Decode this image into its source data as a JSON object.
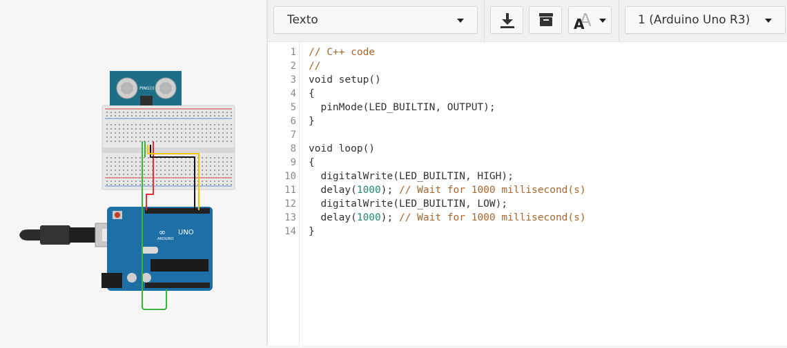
{
  "toolbar": {
    "mode_select": "Texto",
    "download_icon": "download-icon",
    "library_icon": "library-icon",
    "font_size_icon": "font-size-icon",
    "font_size_glyph": "A",
    "board_select": "1 (Arduino Uno R3)"
  },
  "circuit": {
    "usb_cable_icon": "usb-cable-icon",
    "arduino_icon": "arduino-uno-icon",
    "breadboard_icon": "breadboard-icon",
    "sensor_icon": "ultrasonic-sensor-icon",
    "board_logo_text": "UNO",
    "board_brand_text": "ARDUINO",
    "sensor_label": "PING)))"
  },
  "editor": {
    "line_numbers": [
      "1",
      "2",
      "3",
      "4",
      "5",
      "6",
      "7",
      "8",
      "9",
      "10",
      "11",
      "12",
      "13",
      "14"
    ],
    "lines": [
      [
        {
          "t": "// C++ code",
          "c": "comment"
        }
      ],
      [
        {
          "t": "//",
          "c": "comment"
        }
      ],
      [
        {
          "t": "void setup()",
          "c": "plain"
        }
      ],
      [
        {
          "t": "{",
          "c": "plain"
        }
      ],
      [
        {
          "t": "  pinMode(LED_BUILTIN, OUTPUT);",
          "c": "plain"
        }
      ],
      [
        {
          "t": "}",
          "c": "plain"
        }
      ],
      [
        {
          "t": "",
          "c": "plain"
        }
      ],
      [
        {
          "t": "void loop()",
          "c": "plain"
        }
      ],
      [
        {
          "t": "{",
          "c": "plain"
        }
      ],
      [
        {
          "t": "  digitalWrite(LED_BUILTIN, HIGH);",
          "c": "plain"
        }
      ],
      [
        {
          "t": "  delay(",
          "c": "plain"
        },
        {
          "t": "1000",
          "c": "num"
        },
        {
          "t": "); ",
          "c": "plain"
        },
        {
          "t": "// Wait for 1000 millisecond(s)",
          "c": "comment"
        }
      ],
      [
        {
          "t": "  digitalWrite(LED_BUILTIN, LOW);",
          "c": "plain"
        }
      ],
      [
        {
          "t": "  delay(",
          "c": "plain"
        },
        {
          "t": "1000",
          "c": "num"
        },
        {
          "t": "); ",
          "c": "plain"
        },
        {
          "t": "// Wait for 1000 millisecond(s)",
          "c": "comment"
        }
      ],
      [
        {
          "t": "}",
          "c": "plain"
        }
      ]
    ]
  },
  "colors": {
    "comment": "#a8652b",
    "number": "#1f8a6c",
    "board": "#1e6fa6",
    "sensor": "#1c6f86"
  }
}
